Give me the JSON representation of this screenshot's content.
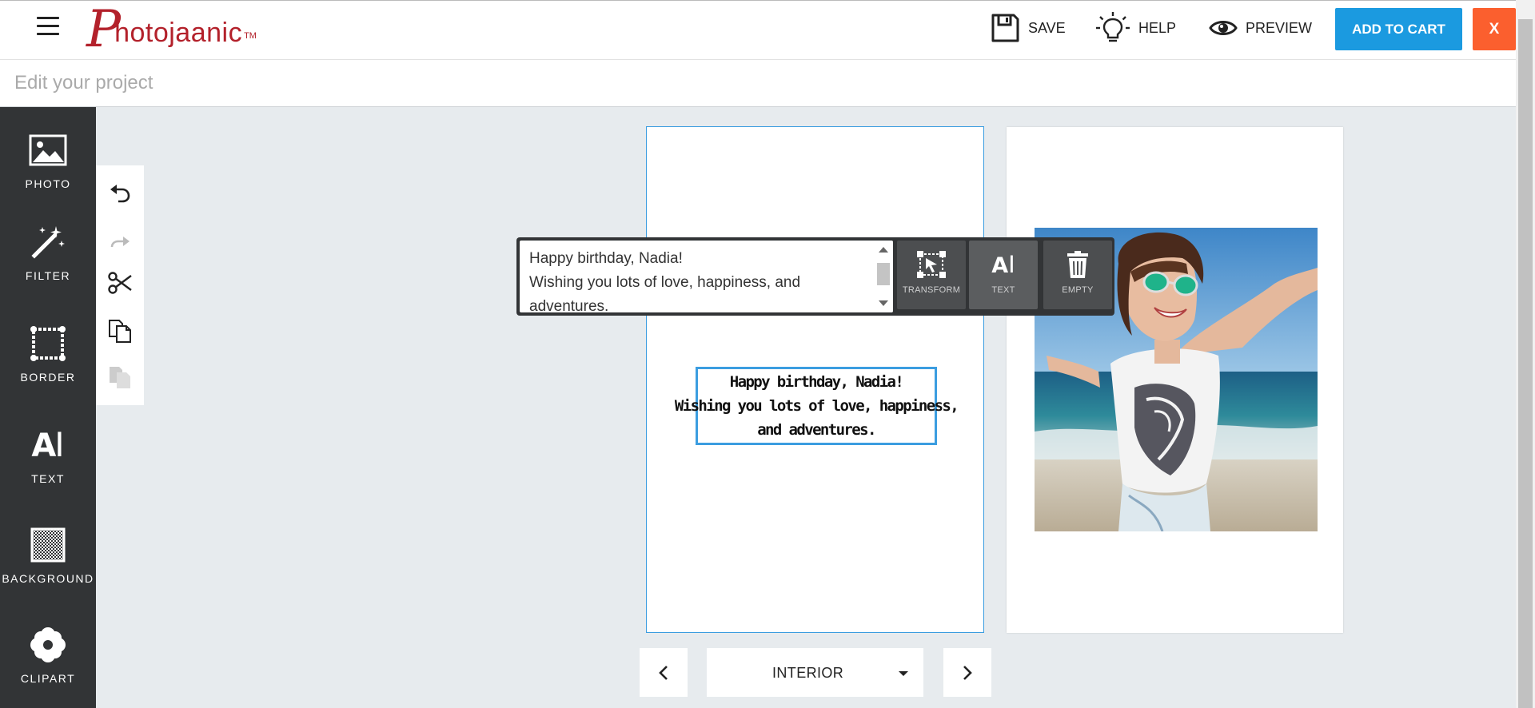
{
  "app": {
    "brand_first_letter": "P",
    "brand_rest": "hotojaanic",
    "brand_tm": "TM"
  },
  "header": {
    "save_label": "SAVE",
    "help_label": "HELP",
    "preview_label": "PREVIEW",
    "add_to_cart_label": "ADD TO CART",
    "close_label": "X"
  },
  "project": {
    "placeholder": "Edit your project",
    "value": ""
  },
  "sidebar": {
    "items": [
      {
        "label": "PHOTO",
        "icon": "photo-icon"
      },
      {
        "label": "FILTER",
        "icon": "magic-wand-icon"
      },
      {
        "label": "BORDER",
        "icon": "border-icon"
      },
      {
        "label": "TEXT",
        "icon": "text-icon"
      },
      {
        "label": "BACKGROUND",
        "icon": "checker-icon"
      },
      {
        "label": "CLIPART",
        "icon": "flower-icon"
      }
    ]
  },
  "tools": {
    "items": [
      "undo-icon",
      "redo-icon",
      "scissors-icon",
      "copy-icon",
      "paste-icon"
    ]
  },
  "card": {
    "text_lines": [
      "Happy birthday, Nadia!",
      "Wishing you lots of love, happiness,",
      "and adventures."
    ]
  },
  "editor": {
    "text_value": "Happy birthday, Nadia!\nWishing you lots of love, happiness, and adventures.",
    "transform_label": "TRANSFORM",
    "text_label": "TEXT",
    "empty_label": "EMPTY"
  },
  "nav": {
    "selected_section": "INTERIOR"
  },
  "colors": {
    "brand_red": "#b3212b",
    "cart_blue": "#1b9ae0",
    "close_orange": "#fb5f2e",
    "selection_blue": "#3b9de0",
    "sidebar_dark": "#323436"
  }
}
